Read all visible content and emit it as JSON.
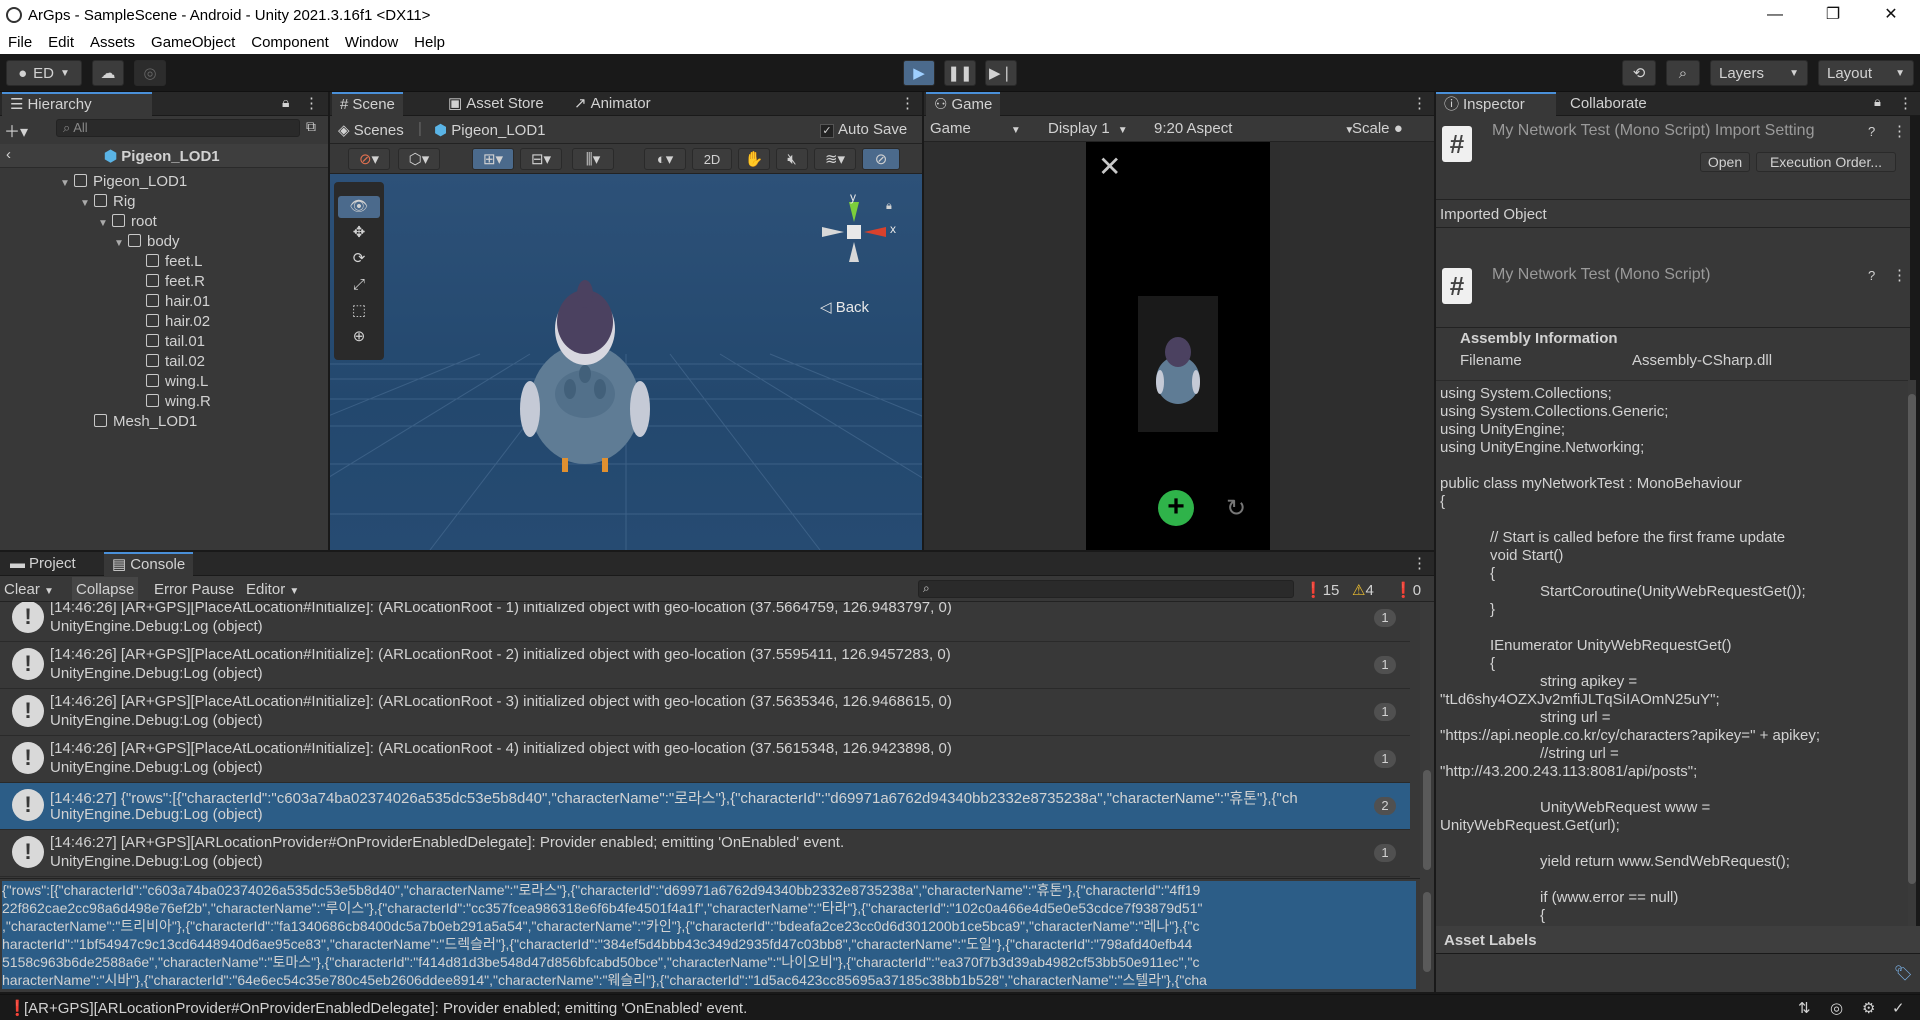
{
  "window": {
    "title": "ArGps - SampleScene - Android - Unity 2021.3.16f1 <DX11>",
    "min_glyph": "—",
    "max_glyph": "❐",
    "close_glyph": "✕"
  },
  "menu": [
    "File",
    "Edit",
    "Assets",
    "GameObject",
    "Component",
    "Window",
    "Help"
  ],
  "toolbar": {
    "account": "ED",
    "layers": "Layers",
    "layout": "Layout"
  },
  "hierarchy": {
    "tab": "Hierarchy",
    "search_placeholder": "All",
    "prefab_title": "Pigeon_LOD1",
    "items": [
      "Pigeon_LOD1",
      "Rig",
      "root",
      "body",
      "feet.L",
      "feet.R",
      "hair.01",
      "hair.02",
      "tail.01",
      "tail.02",
      "wing.L",
      "wing.R",
      "Mesh_LOD1"
    ]
  },
  "scene": {
    "tabs": [
      "Scene",
      "Asset Store",
      "Animator"
    ],
    "breadcrumb_root": "Scenes",
    "breadcrumb_item": "Pigeon_LOD1",
    "auto_save": "Auto Save",
    "twod": "2D",
    "back": "Back",
    "axis_y": "y",
    "axis_x": "x"
  },
  "game": {
    "tab": "Game",
    "mode": "Game",
    "display": "Display 1",
    "aspect": "9:20 Aspect",
    "scale": "Scale"
  },
  "inspector": {
    "tabs": [
      "Inspector",
      "Collaborate"
    ],
    "import_title": "My Network Test (Mono Script) Import Setting",
    "open_btn": "Open",
    "exec_btn": "Execution Order...",
    "imported_object": "Imported Object",
    "script_title": "My Network Test (Mono Script)",
    "assembly_info": "Assembly Information",
    "filename_label": "Filename",
    "filename_value": "Assembly-CSharp.dll",
    "asset_labels": "Asset Labels",
    "code_lines": [
      "using System.Collections;",
      "using System.Collections.Generic;",
      "using UnityEngine;",
      "using UnityEngine.Networking;",
      "",
      "public class myNetworkTest : MonoBehaviour",
      "{",
      "",
      "            // Start is called before the first frame update",
      "            void Start()",
      "            {",
      "                        StartCoroutine(UnityWebRequestGet());",
      "            }",
      "",
      "            IEnumerator UnityWebRequestGet()",
      "            {",
      "                        string apikey =",
      "\"tLd6shy4OZXJv2mfiJLTqSiIAOmN25uY\";",
      "                        string url =",
      "\"https://api.neople.co.kr/cy/characters?apikey=\" + apikey;",
      "                        //string url =",
      "\"http://43.200.243.113:8081/api/posts\";",
      "",
      "                        UnityWebRequest www =",
      "UnityWebRequest.Get(url);",
      "",
      "                        yield return www.SendWebRequest();",
      "",
      "                        if (www.error == null)",
      "                        {"
    ]
  },
  "console": {
    "tabs": [
      "Project",
      "Console"
    ],
    "clear": "Clear",
    "collapse": "Collapse",
    "error_pause": "Error Pause",
    "editor": "Editor",
    "count_log": "15",
    "count_warn": "4",
    "count_err": "0",
    "rows": [
      {
        "l1": "[14:46:26] [AR+GPS][PlaceAtLocation#Initialize]: (ARLocationRoot - 1) initialized object with geo-location (37.5664759, 126.9483797, 0)",
        "l2": "UnityEngine.Debug:Log (object)",
        "count": "1"
      },
      {
        "l1": "[14:46:26] [AR+GPS][PlaceAtLocation#Initialize]: (ARLocationRoot - 2) initialized object with geo-location (37.5595411, 126.9457283, 0)",
        "l2": "UnityEngine.Debug:Log (object)",
        "count": "1"
      },
      {
        "l1": "[14:46:26] [AR+GPS][PlaceAtLocation#Initialize]: (ARLocationRoot - 3) initialized object with geo-location (37.5635346, 126.9468615, 0)",
        "l2": "UnityEngine.Debug:Log (object)",
        "count": "1"
      },
      {
        "l1": "[14:46:26] [AR+GPS][PlaceAtLocation#Initialize]: (ARLocationRoot - 4) initialized object with geo-location (37.5615348, 126.9423898, 0)",
        "l2": "UnityEngine.Debug:Log (object)",
        "count": "1"
      },
      {
        "l1": "[14:46:27] {\"rows\":[{\"characterId\":\"c603a74ba02374026a535dc53e5b8d40\",\"characterName\":\"로라스\"},{\"characterId\":\"d69971a6762d94340bb2332e8735238a\",\"characterName\":\"휴톤\"},{\"ch",
        "l2": "UnityEngine.Debug:Log (object)",
        "count": "2"
      },
      {
        "l1": "[14:46:27] [AR+GPS][ARLocationProvider#OnProviderEnabledDelegate]: Provider enabled; emitting 'OnEnabled' event.",
        "l2": "UnityEngine.Debug:Log (object)",
        "count": "1"
      }
    ],
    "detail_lines": [
      "{\"rows\":[{\"characterId\":\"c603a74ba02374026a535dc53e5b8d40\",\"characterName\":\"로라스\"},{\"characterId\":\"d69971a6762d94340bb2332e8735238a\",\"characterName\":\"휴톤\"},{\"characterId\":\"4ff19",
      "22f862cae2cc98a6d498e76ef2b\",\"characterName\":\"루이스\"},{\"characterId\":\"cc357fcea986318e6f6b4fe4501f4a1f\",\"characterName\":\"타라\"},{\"characterId\":\"102c0a466e4d5e0e53cdce7f93879d51\"",
      ",\"characterName\":\"트리비아\"},{\"characterId\":\"fa1340686cb8400dc5a7b0eb291a5a54\",\"characterName\":\"카인\"},{\"characterId\":\"bdeafa2ce23cc0d6d301200b1ce5bca9\",\"characterName\":\"레나\"},{\"c",
      "haracterId\":\"1bf54947c9c13cd6448940d6ae95ce83\",\"characterName\":\"드렉슬러\"},{\"characterId\":\"384ef5d4bbb43c349d2935fd47c03bb8\",\"characterName\":\"도일\"},{\"characterId\":\"798afd40efb44",
      "5158c963b6de2588a6e\",\"characterName\":\"토마스\"},{\"characterId\":\"f414d81d3be548d47d856bfcabd50bce\",\"characterName\":\"나이오비\"},{\"characterId\":\"ea370f7b3d39ab4982cf53bb50e911ec\",\"c",
      "haracterName\":\"시바\"},{\"characterId\":\"64e6ec54c35e780c45eb2606ddee8914\",\"characterName\":\"웨슬리\"},{\"characterId\":\"1d5ac6423cc85695a37185c38bb1b528\",\"characterName\":\"스텔라\"},{\"cha"
    ]
  },
  "statusbar": {
    "text": "[AR+GPS][ARLocationProvider#OnProviderEnabledDelegate]: Provider enabled; emitting 'OnEnabled' event."
  },
  "colors": {
    "accent": "#4a90d9",
    "selection": "#2c5d87",
    "game_button_green": "#2fb34a"
  }
}
